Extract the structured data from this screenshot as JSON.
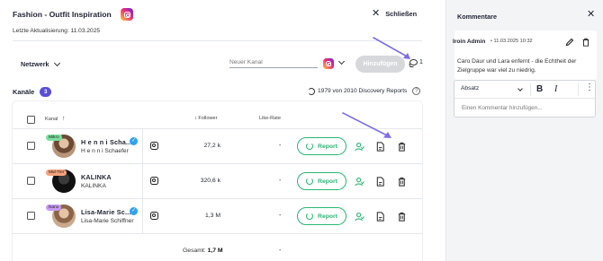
{
  "header": {
    "title": "Fashion - Outfit Inspiration",
    "close_label": "Schließen",
    "updated": "Letzte Aktualisierung: 11.03.2025"
  },
  "filters": {
    "network_label": "Netzwerk",
    "channel_placeholder": "Neuer Kanal",
    "add_label": "Hinzufügen",
    "comment_count": "1"
  },
  "channels": {
    "label": "Kanäle",
    "count": "3",
    "reports_info": "1979 von 2010 Discovery Reports"
  },
  "table": {
    "headers": {
      "kanal": "Kanal",
      "followers": "Follower",
      "likes": "Like-Rate"
    },
    "rows": [
      {
        "tag": "Mikro",
        "name": "H e n n i Scha...",
        "handle": "H e n n i Schaefer",
        "followers": "27,2 k",
        "like_rate": "-",
        "report": "Report",
        "verified": true
      },
      {
        "tag": "Mid-Tier",
        "name": "KALINKA",
        "handle": "KALINKA",
        "followers": "320,6 k",
        "like_rate": "-",
        "report": "Report",
        "verified": false
      },
      {
        "tag": "Nano",
        "name": "Lisa-Marie Sc...",
        "handle": "Lisa-Marie Schiffner",
        "followers": "1,3 M",
        "like_rate": "-",
        "report": "Report",
        "verified": true
      }
    ],
    "total_label": "Gesamt:",
    "total_value": "1,7 M",
    "total_like_rate": "-"
  },
  "comments_panel": {
    "title": "Kommentare",
    "comment": {
      "author": "Iroin Admin",
      "date": "11.03.2025 10:32",
      "text": "Caro Daur und Lara enfernt - die Echtheit der Zielgruppe war viel zu niedrig."
    },
    "editor": {
      "format": "Absatz",
      "placeholder": "Einen Kommentar hinzufügen..."
    }
  },
  "colors": {
    "accent": "#5a4fd6",
    "report_green": "#2bb673",
    "arrow": "#7c6ee6"
  }
}
